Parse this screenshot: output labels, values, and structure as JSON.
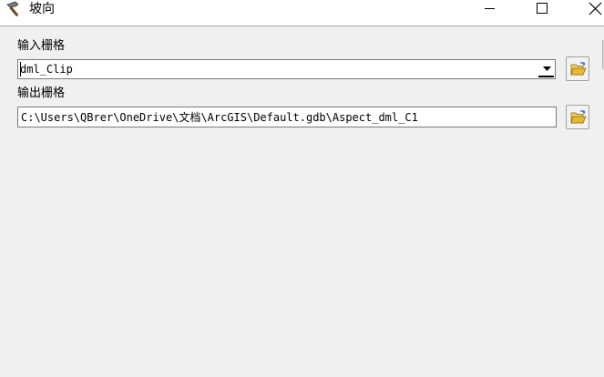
{
  "window": {
    "title": "坡向",
    "app_icon": "hammer-icon",
    "controls": [
      "minimize-icon",
      "maximize-icon",
      "close-icon"
    ]
  },
  "form": {
    "input_raster": {
      "label": "输入栅格",
      "value": "dml_Clip",
      "browse_icon": "open-folder-icon"
    },
    "output_raster": {
      "label": "输出栅格",
      "value": "C:\\Users\\QBrer\\OneDrive\\文档\\ArcGIS\\Default.gdb\\Aspect_dml_C1",
      "browse_icon": "open-folder-icon"
    }
  },
  "colors": {
    "background": "#f0f0f0",
    "titlebar": "#ffffff",
    "folder": "#e8b830"
  }
}
